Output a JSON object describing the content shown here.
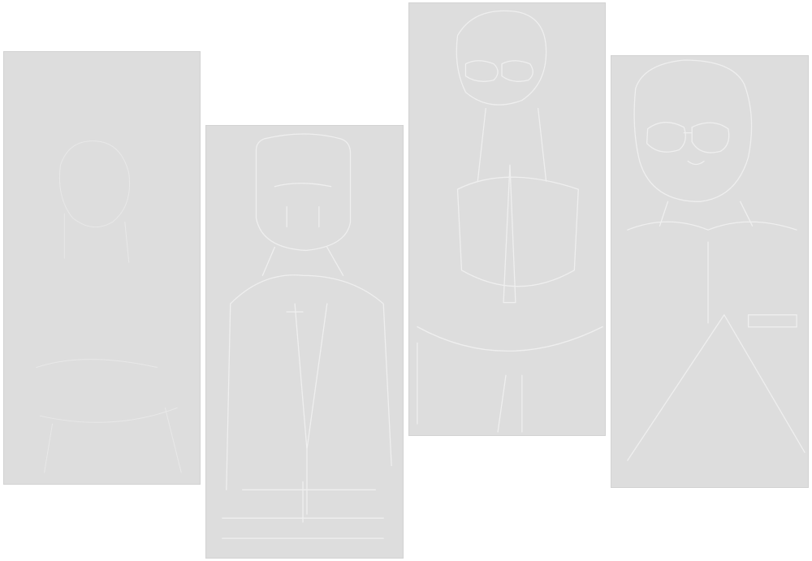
{
  "canvas": {
    "background": "#ffffff"
  },
  "panels": [
    {
      "name": "panel-1",
      "fill": "#dddddd",
      "border": "#d2d2d2",
      "sketch": "very-faint-figure"
    },
    {
      "name": "panel-2",
      "fill": "#dddddd",
      "border": "#d2d2d2",
      "sketch": "standing-figure-in-suit"
    },
    {
      "name": "panel-3",
      "fill": "#dddddd",
      "border": "#d2d2d2",
      "sketch": "figure-with-glasses-and-tie"
    },
    {
      "name": "panel-4",
      "fill": "#dddddd",
      "border": "#d2d2d2",
      "sketch": "figure-with-round-glasses"
    }
  ],
  "sketch_line_color": "#efefef"
}
